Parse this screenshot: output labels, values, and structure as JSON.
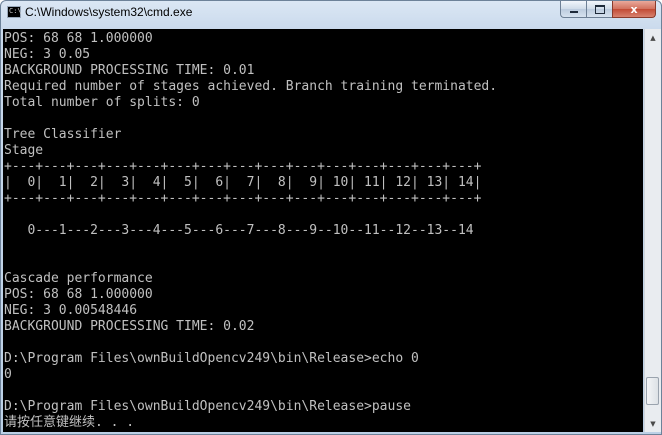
{
  "window": {
    "title": "C:\\Windows\\system32\\cmd.exe",
    "icon_glyph": "C:\\",
    "icon": "cmd-icon",
    "minimize_icon": "minimize-icon",
    "maximize_icon": "maximize-icon",
    "close_label": "x"
  },
  "console": {
    "foreground": "#c0c0c0",
    "background": "#000000",
    "lines": [
      "POS: 68 68 1.000000",
      "NEG: 3 0.05",
      "BACKGROUND PROCESSING TIME: 0.01",
      "Required number of stages achieved. Branch training terminated.",
      "Total number of splits: 0",
      "",
      "Tree Classifier",
      "Stage",
      "+---+---+---+---+---+---+---+---+---+---+---+---+---+---+---+",
      "|  0|  1|  2|  3|  4|  5|  6|  7|  8|  9| 10| 11| 12| 13| 14|",
      "+---+---+---+---+---+---+---+---+---+---+---+---+---+---+---+",
      "",
      "   0---1---2---3---4---5---6---7---8---9--10--11--12--13--14",
      "",
      "",
      "Cascade performance",
      "POS: 68 68 1.000000",
      "NEG: 3 0.00548446",
      "BACKGROUND PROCESSING TIME: 0.02",
      "",
      "D:\\Program Files\\ownBuildOpencv249\\bin\\Release>echo 0",
      "0",
      "",
      "D:\\Program Files\\ownBuildOpencv249\\bin\\Release>pause",
      "请按任意键继续. . ."
    ]
  },
  "scrollbar": {
    "up_icon": "scroll-up-arrow-icon",
    "down_icon": "scroll-down-arrow-icon",
    "position": 0.97
  }
}
